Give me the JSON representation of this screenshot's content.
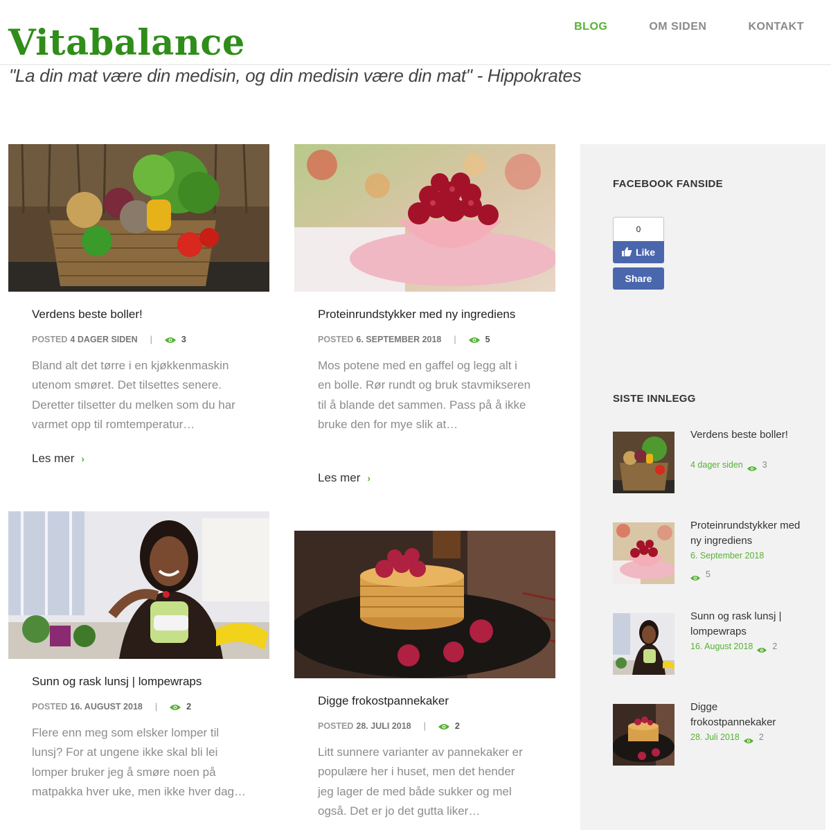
{
  "header": {
    "logo": "Vitabalance",
    "nav": [
      "BLOG",
      "OM SIDEN",
      "KONTAKT"
    ],
    "tagline": "\"La din mat være din medisin, og din medisin være din mat\" - Hippokrates"
  },
  "posts": [
    {
      "title": "Verdens beste boller!",
      "posted_label": "POSTED",
      "date": "4 DAGER SIDEN",
      "views": "3",
      "excerpt": "Bland alt det tørre i en kjøkkenmaskin utenom smøret. Det tilsettes senere. Deretter tilsetter du melken som du har varmet opp til romtemperatur…",
      "more": "Les mer"
    },
    {
      "title": "Proteinrundstykker med ny ingrediens",
      "posted_label": "POSTED",
      "date": "6. SEPTEMBER 2018",
      "views": "5",
      "excerpt": "Mos potene med en gaffel og legg alt i en bolle. Rør rundt og bruk stavmikseren til å blande det sammen. Pass på å ikke bruke den for mye slik at…",
      "more": "Les mer"
    },
    {
      "title": "Sunn og rask lunsj | lompewraps",
      "posted_label": "POSTED",
      "date": "16. AUGUST 2018",
      "views": "2",
      "excerpt": "Flere enn meg som elsker lomper til lunsj? For at ungene ikke skal bli lei lomper bruker jeg å smøre noen på matpakka hver uke, men ikke hver dag…",
      "more": "Les mer"
    },
    {
      "title": "Digge frokostpannekaker",
      "posted_label": "POSTED",
      "date": "28. JULI 2018",
      "views": "2",
      "excerpt": "Litt sunnere varianter av pannekaker er populære her i huset, men det hender jeg lager de med både sukker og mel også. Det er jo det gutta liker…",
      "more": "Les mer"
    }
  ],
  "sidebar": {
    "facebook_heading": "FACEBOOK FANSIDE",
    "fb_count": "0",
    "fb_like": "Like",
    "fb_share": "Share",
    "recent_heading": "SISTE INNLEGG",
    "recent": [
      {
        "title": "Verdens beste boller!",
        "date": "4 dager siden",
        "views": "3"
      },
      {
        "title": "Proteinrundstykker med ny ingrediens",
        "date": "6. September 2018",
        "views": "5"
      },
      {
        "title": "Sunn og rask lunsj | lompewraps",
        "date": "16. August 2018",
        "views": "2"
      },
      {
        "title": "Digge frokostpannekaker",
        "date": "28. Juli 2018",
        "views": "2"
      }
    ]
  },
  "colors": {
    "accent": "#55b233",
    "logo": "#2f8d1a",
    "facebook": "#4a67ad",
    "sidebar_bg": "#f2f2f2"
  },
  "icons": [
    "eye-icon",
    "chevron-right-icon",
    "thumbs-up-icon"
  ]
}
